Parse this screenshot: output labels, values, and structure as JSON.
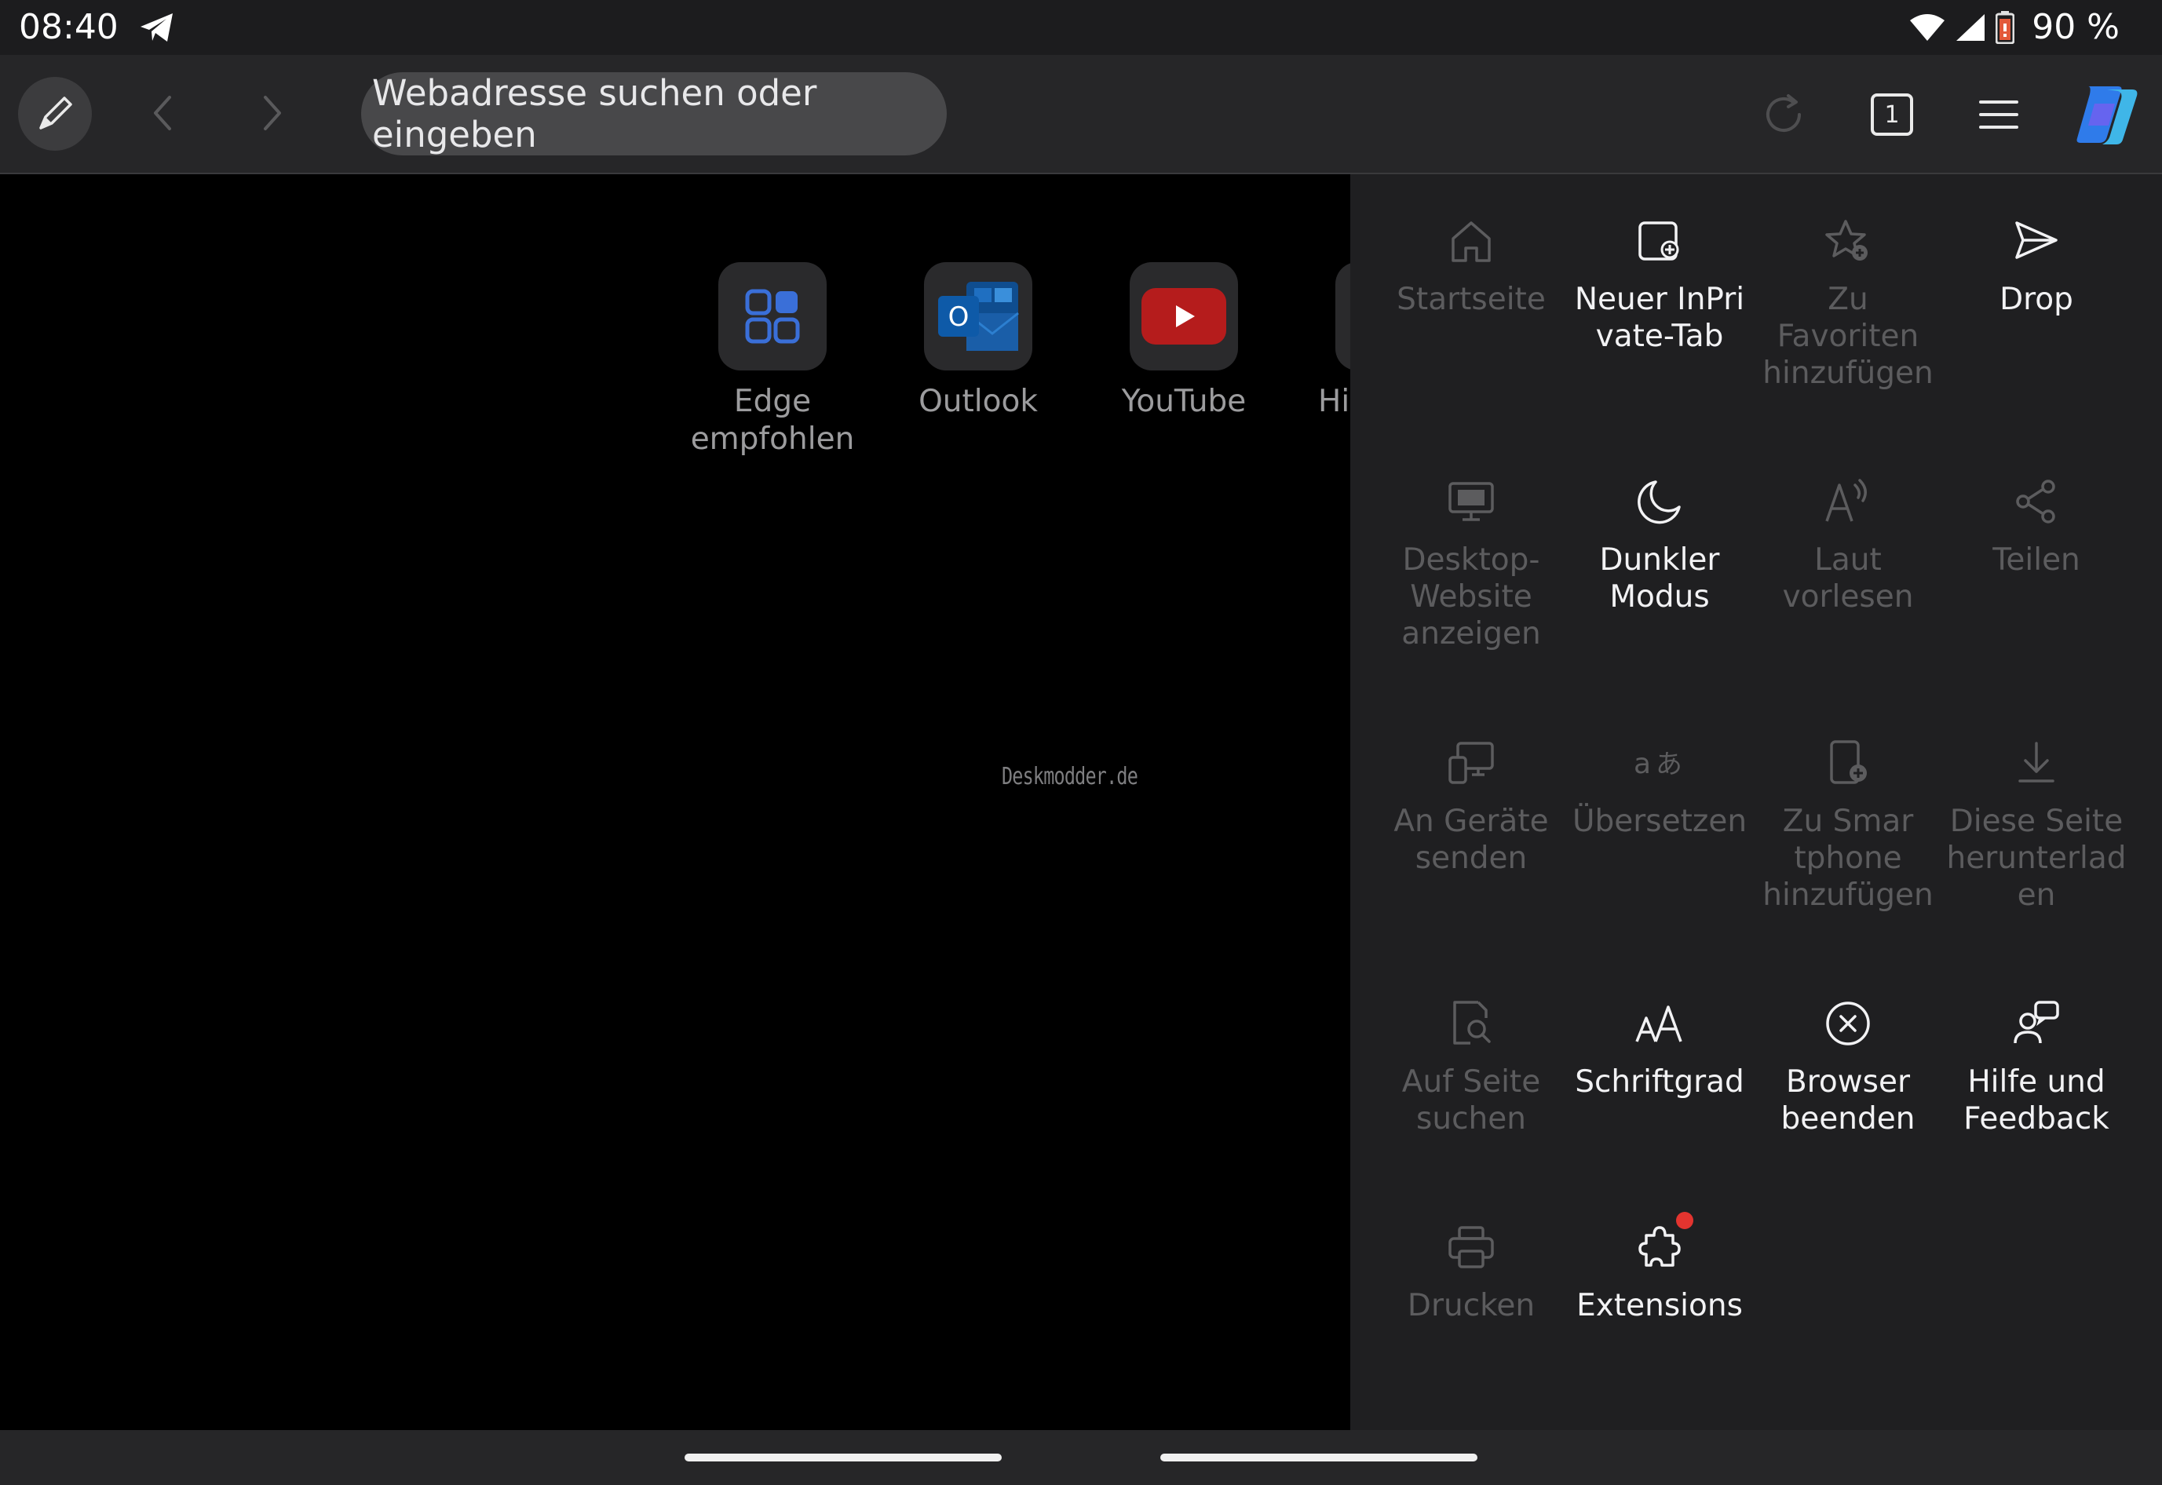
{
  "status_bar": {
    "time": "08:40",
    "battery_percent": "90 %",
    "icons": [
      "telegram-icon",
      "wifi-icon",
      "cell-signal-icon",
      "battery-icon"
    ]
  },
  "toolbar": {
    "address_placeholder": "Webadresse suchen oder eingeben",
    "tab_count": "1",
    "icons": [
      "pen-icon",
      "back-icon",
      "forward-icon",
      "reload-icon",
      "tabs-icon",
      "menu-icon",
      "copilot-icon"
    ]
  },
  "shortcuts": [
    {
      "label": "Edge empfohlen",
      "icon": "edge-apps-icon"
    },
    {
      "label": "Outlook",
      "icon": "outlook-icon"
    },
    {
      "label": "YouTube",
      "icon": "youtube-icon"
    },
    {
      "label": "Hi",
      "icon": "tile-icon"
    }
  ],
  "watermark": "Deskmodder.de",
  "menu": {
    "items": [
      {
        "label": "Startseite",
        "icon": "home-icon",
        "enabled": false
      },
      {
        "label": "Neuer InPri vate-Tab",
        "icon": "inprivate-tab-icon",
        "enabled": true
      },
      {
        "label": "Zu Favoriten hinzufügen",
        "icon": "favorite-add-icon",
        "enabled": false
      },
      {
        "label": "Drop",
        "icon": "drop-send-icon",
        "enabled": true
      },
      {
        "label": "Desktop-Website anzeigen",
        "icon": "desktop-icon",
        "enabled": false
      },
      {
        "label": "Dunkler Modus",
        "icon": "moon-icon",
        "enabled": true
      },
      {
        "label": "Laut vorlesen",
        "icon": "read-aloud-icon",
        "enabled": false
      },
      {
        "label": "Teilen",
        "icon": "share-icon",
        "enabled": false
      },
      {
        "label": "An Geräte senden",
        "icon": "send-to-devices-icon",
        "enabled": false
      },
      {
        "label": "Übersetzen",
        "icon": "translate-icon",
        "enabled": false
      },
      {
        "label": "Zu Smar tphone hinzufügen",
        "icon": "add-to-phone-icon",
        "enabled": false
      },
      {
        "label": "Diese Seite herunterlad en",
        "icon": "download-icon",
        "enabled": false
      },
      {
        "label": "Auf Seite suchen",
        "icon": "find-on-page-icon",
        "enabled": false
      },
      {
        "label": "Schriftgrad",
        "icon": "font-size-icon",
        "enabled": true
      },
      {
        "label": "Browser beenden",
        "icon": "close-circle-icon",
        "enabled": true
      },
      {
        "label": "Hilfe und Feedback",
        "icon": "help-feedback-icon",
        "enabled": true
      },
      {
        "label": "Drucken",
        "icon": "print-icon",
        "enabled": false
      },
      {
        "label": "Extensions",
        "icon": "extensions-icon",
        "enabled": true,
        "badge": true
      }
    ]
  },
  "colors": {
    "menu_bg": "#1f1f21",
    "toolbar_bg": "#262628",
    "badge": "#e3342f",
    "copilot_blue": "#2f7bea",
    "youtube_red": "#b51c1c"
  }
}
